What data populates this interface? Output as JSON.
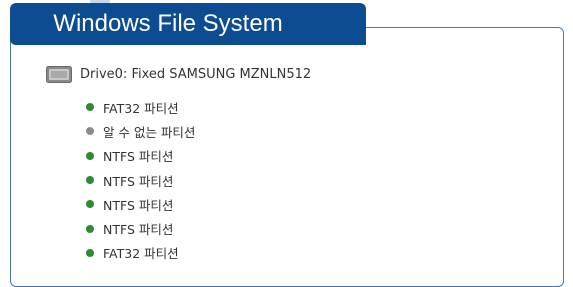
{
  "header": {
    "title": "Windows File System",
    "color": "#0d4c91"
  },
  "drive": {
    "label": "Drive0: Fixed SAMSUNG MZNLN512",
    "icon": "hard-drive-icon"
  },
  "partitions": [
    {
      "label": "FAT32 파티션",
      "status": "known",
      "color": "#2e8b2e"
    },
    {
      "label": "알 수 없는 파티션",
      "status": "unknown",
      "color": "#8c8c8c"
    },
    {
      "label": "NTFS 파티션",
      "status": "known",
      "color": "#2e8b2e"
    },
    {
      "label": "NTFS 파티션",
      "status": "known",
      "color": "#2e8b2e"
    },
    {
      "label": "NTFS 파티션",
      "status": "known",
      "color": "#2e8b2e"
    },
    {
      "label": "NTFS 파티션",
      "status": "known",
      "color": "#2e8b2e"
    },
    {
      "label": "FAT32 파티션",
      "status": "known",
      "color": "#2e8b2e"
    }
  ]
}
